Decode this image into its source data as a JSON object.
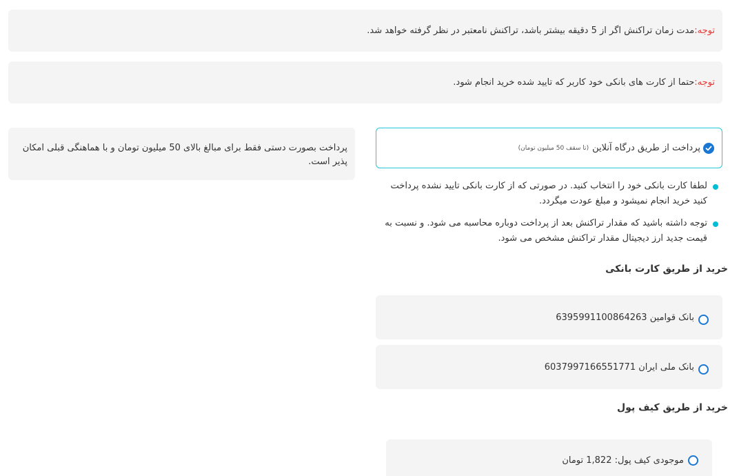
{
  "notices": [
    {
      "label": "توجه:",
      "text": " مدت زمان تراکنش اگر از 5 دقیقه بیشتر باشد، تراکنش نامعتبر در نظر گرفته خواهد شد."
    },
    {
      "label": "توجه:",
      "text": " حتما از کارت های بانکی خود کاربر که تایید شده خرید انجام شود."
    }
  ],
  "manual_payment": {
    "text": "پرداخت بصورت دستی فقط برای مبالغ بالای 50 میلیون تومان و با هماهنگی قبلی امکان پذیر است."
  },
  "online_payment": {
    "label": "پرداخت از طریق درگاه آنلاین",
    "note": "(تا سقف 50 میلیون تومان)",
    "selected": true
  },
  "bullets": [
    "لطفا کارت بانکی خود را انتخاب کنید. در صورتی که از کارت بانکی تایید نشده پرداخت کنید خرید انجام نمیشود و مبلغ عودت میگردد.",
    "توجه داشته باشید که مقدار تراکنش بعد از پرداخت دوباره محاسبه می شود. و نسبت به قیمت جدید ارز دیجیتال مقدار تراکنش مشخص می شود."
  ],
  "bank_section": {
    "title": "خرید از طریق کارت بانکی",
    "cards": [
      {
        "label": "بانک قوامین 6395991100864263"
      },
      {
        "label": "بانک ملی ایران 6037997166551771"
      }
    ]
  },
  "wallet_section": {
    "title": "خرید از طریق کیف پول",
    "balance_label": "موجودی کیف پول: 1,822 تومان"
  },
  "colors": {
    "accent": "#26c6da",
    "warning": "#e53935",
    "radio": "#1976d2",
    "panel": "#f4f4f4"
  }
}
